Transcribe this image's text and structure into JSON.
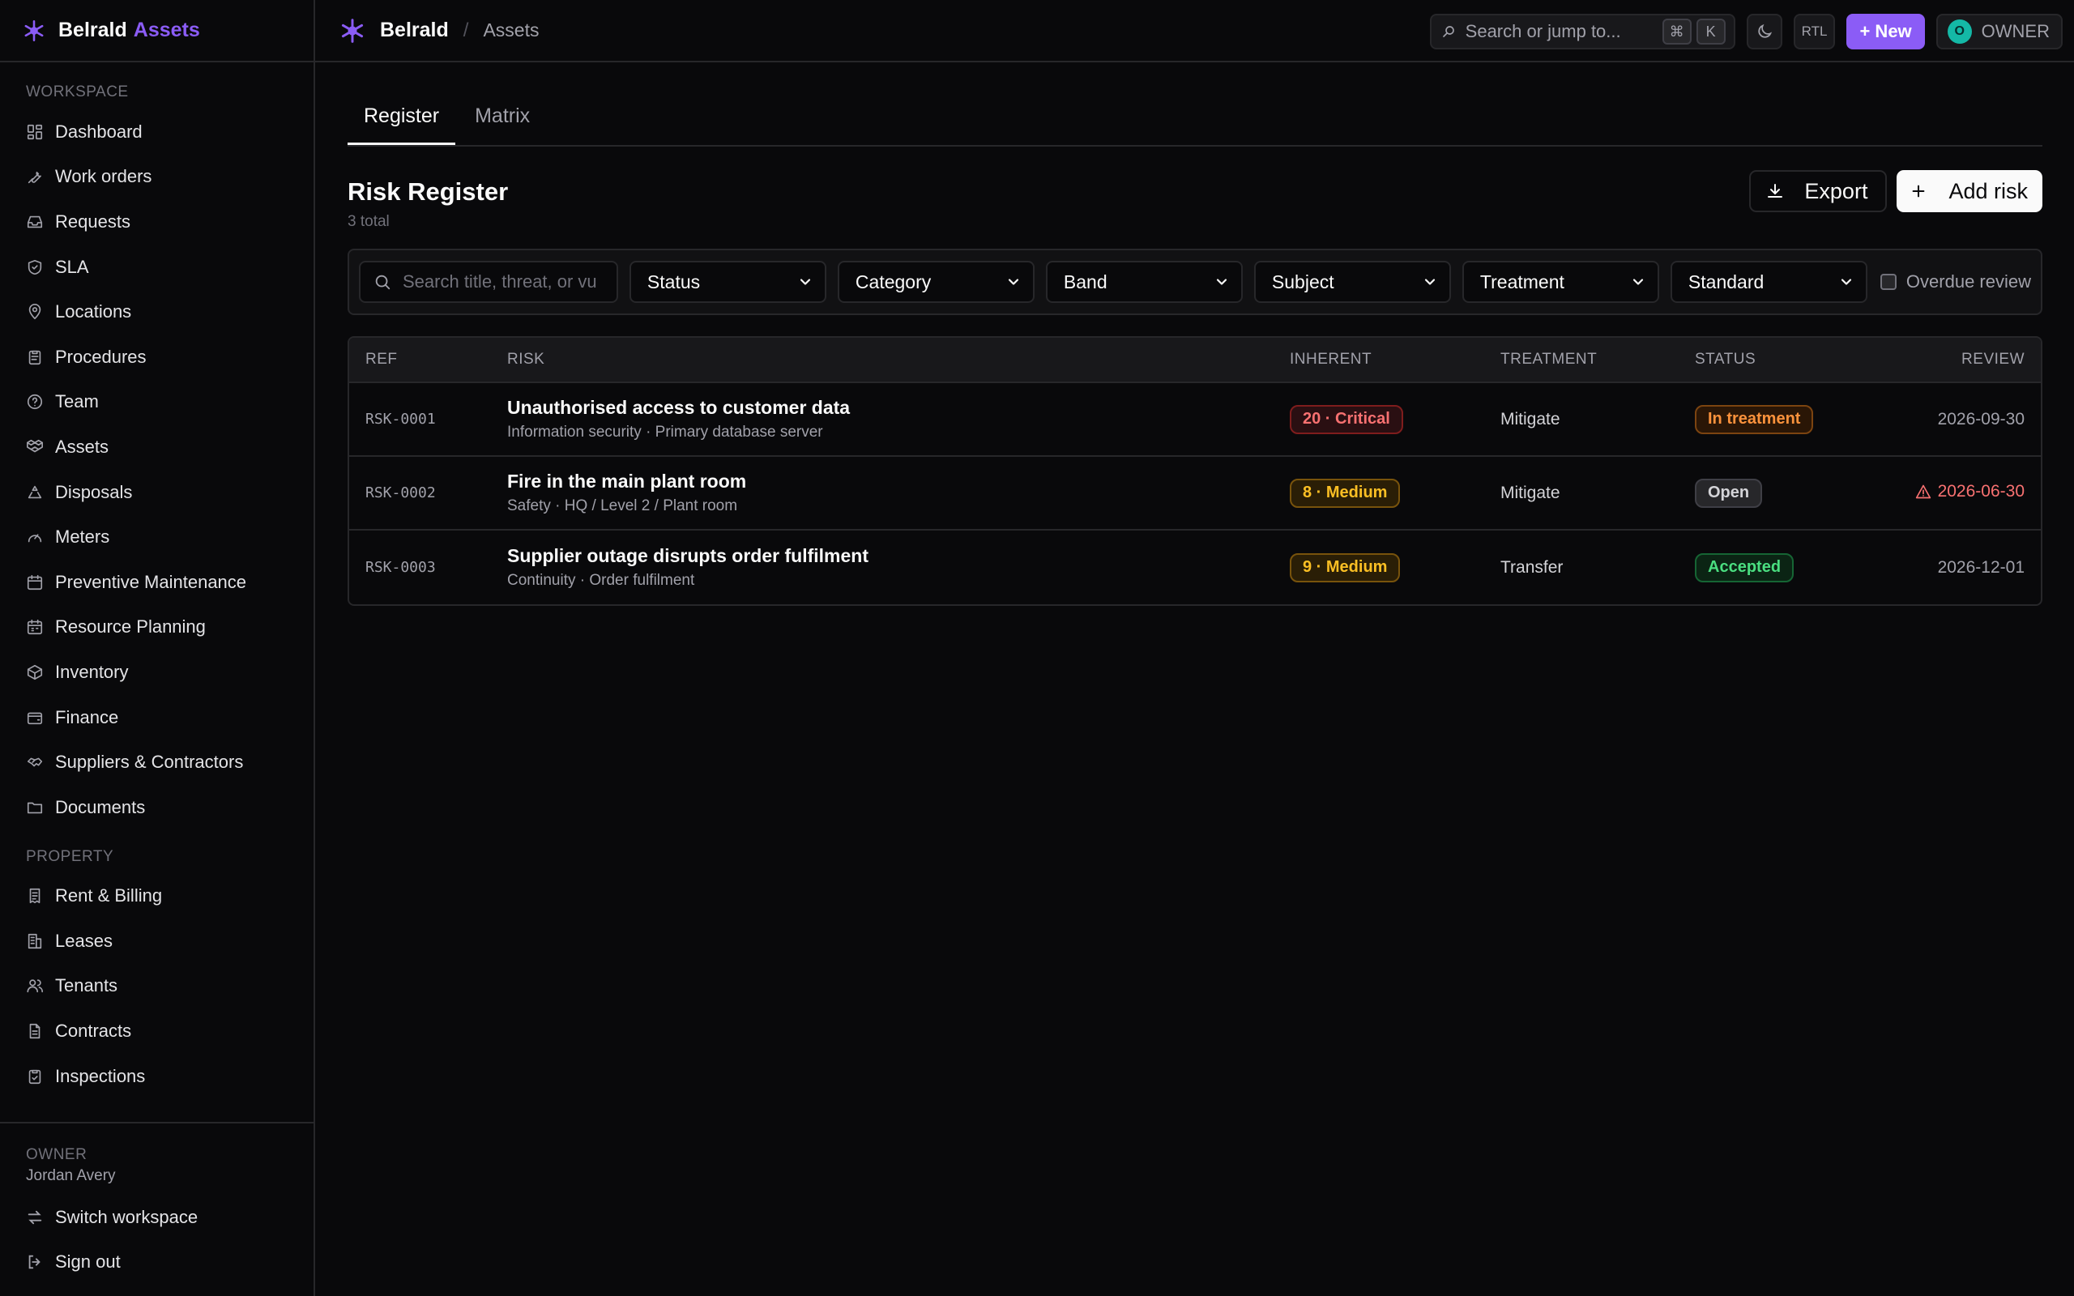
{
  "brand": {
    "name": "Belrald",
    "accent": "Assets"
  },
  "sidebar": {
    "sections": [
      {
        "label": "WORKSPACE",
        "items": [
          {
            "label": "Dashboard",
            "icon": "dashboard-icon"
          },
          {
            "label": "Work orders",
            "icon": "wrench-icon"
          },
          {
            "label": "Requests",
            "icon": "inbox-icon"
          },
          {
            "label": "SLA",
            "icon": "shield-icon"
          },
          {
            "label": "Locations",
            "icon": "map-pin-icon"
          },
          {
            "label": "Procedures",
            "icon": "clipboard-icon"
          },
          {
            "label": "Team",
            "icon": "help-circle-icon"
          },
          {
            "label": "Assets",
            "icon": "boxes-icon"
          },
          {
            "label": "Disposals",
            "icon": "recycle-icon"
          },
          {
            "label": "Meters",
            "icon": "gauge-icon"
          },
          {
            "label": "Preventive Maintenance",
            "icon": "calendar-icon"
          },
          {
            "label": "Resource Planning",
            "icon": "calendar-grid-icon"
          },
          {
            "label": "Inventory",
            "icon": "package-icon"
          },
          {
            "label": "Finance",
            "icon": "wallet-icon"
          },
          {
            "label": "Suppliers & Contractors",
            "icon": "handshake-icon"
          },
          {
            "label": "Documents",
            "icon": "folder-icon"
          }
        ]
      },
      {
        "label": "PROPERTY",
        "items": [
          {
            "label": "Rent & Billing",
            "icon": "receipt-icon"
          },
          {
            "label": "Leases",
            "icon": "building-icon"
          },
          {
            "label": "Tenants",
            "icon": "users-icon"
          },
          {
            "label": "Contracts",
            "icon": "file-icon"
          },
          {
            "label": "Inspections",
            "icon": "clipboard-check-icon"
          }
        ]
      }
    ],
    "footer": {
      "role": "OWNER",
      "name": "Jordan Avery",
      "switch_label": "Switch workspace",
      "signout_label": "Sign out"
    }
  },
  "topbar": {
    "breadcrumb_root": "Belrald",
    "breadcrumb_sep": "/",
    "breadcrumb_leaf": "Assets",
    "search_placeholder": "Search or jump to...",
    "kbd_cmd": "⌘",
    "kbd_key": "K",
    "rtl_label": "RTL",
    "new_label": "+ New",
    "avatar_initial": "O",
    "user_role": "OWNER"
  },
  "tabs": [
    {
      "label": "Register",
      "active": true
    },
    {
      "label": "Matrix",
      "active": false
    }
  ],
  "page": {
    "title": "Risk Register",
    "count": "3 total",
    "export_label": "Export",
    "add_label": "Add risk"
  },
  "filters": {
    "search_placeholder": "Search title, threat, or vu",
    "selects": [
      "Status",
      "Category",
      "Band",
      "Subject",
      "Treatment",
      "Standard"
    ],
    "overdue_label": "Overdue review"
  },
  "table": {
    "columns": [
      "REF",
      "RISK",
      "INHERENT",
      "TREATMENT",
      "STATUS",
      "REVIEW"
    ],
    "rows": [
      {
        "ref": "RSK-0001",
        "title": "Unauthorised access to customer data",
        "subtitle": "Information security · Primary database server",
        "inherent": "20 · Critical",
        "inherent_level": "critical",
        "treatment": "Mitigate",
        "status": "In treatment",
        "status_kind": "treat",
        "review": "2026-09-30",
        "overdue": false
      },
      {
        "ref": "RSK-0002",
        "title": "Fire in the main plant room",
        "subtitle": "Safety · HQ / Level 2 / Plant room",
        "inherent": "8 · Medium",
        "inherent_level": "medium",
        "treatment": "Mitigate",
        "status": "Open",
        "status_kind": "open",
        "review": "2026-06-30",
        "overdue": true
      },
      {
        "ref": "RSK-0003",
        "title": "Supplier outage disrupts order fulfilment",
        "subtitle": "Continuity · Order fulfilment",
        "inherent": "9 · Medium",
        "inherent_level": "medium",
        "treatment": "Transfer",
        "status": "Accepted",
        "status_kind": "accepted",
        "review": "2026-12-01",
        "overdue": false
      }
    ]
  },
  "colors": {
    "accent": "#8b5cf6",
    "background": "#09090b",
    "border": "#27272a",
    "critical": "#f87171",
    "medium": "#fbbf24",
    "accepted": "#4ade80"
  }
}
